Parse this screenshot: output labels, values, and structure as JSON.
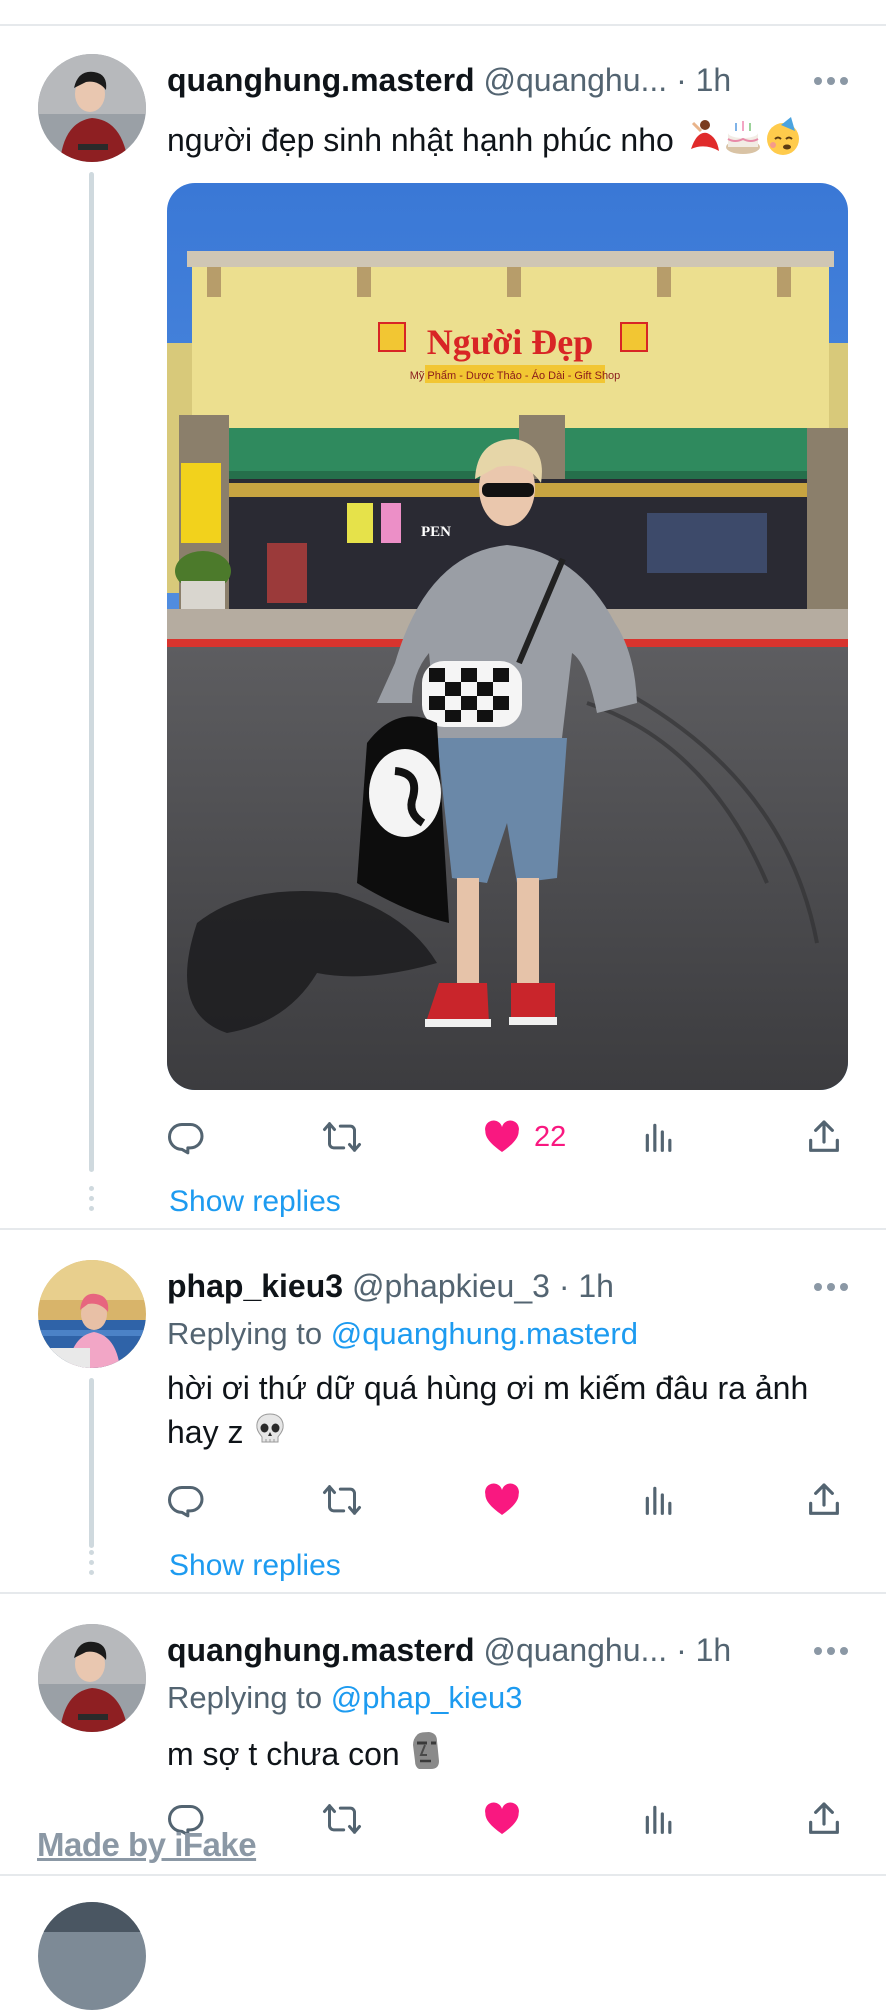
{
  "tweets": [
    {
      "name": "quanghung.masterd",
      "handle": "@quanghu...",
      "time": "· 1h",
      "text": "người đẹp sinh nhật hạnh phúc nho",
      "emojis": [
        "dancer-emoji",
        "birthday-cake-emoji",
        "partying-face-emoji"
      ],
      "photo": {
        "sign_title": "Người Đẹp",
        "sign_subtitle": "Mỹ Phẩm - Dược Thảo - Áo Dài - Gift Shop",
        "door_sign": "PEN"
      },
      "like_count": "22",
      "liked": true,
      "show_replies": "Show replies"
    },
    {
      "name": "phap_kieu3",
      "handle": "@phapkieu_3",
      "time": "· 1h",
      "replying_prefix": "Replying to",
      "replying_to": "@quanghung.masterd",
      "text_line1": "hời ơi thứ dữ quá hùng ơi m kiếm đâu ra ảnh",
      "text_line2": "hay z",
      "emoji": "skull-emoji",
      "liked": true,
      "show_replies": "Show replies"
    },
    {
      "name": "quanghung.masterd",
      "handle": "@quanghu...",
      "time": "· 1h",
      "replying_prefix": "Replying to",
      "replying_to": "@phap_kieu3",
      "text": "m sợ t chưa con",
      "emoji": "moai-emoji",
      "liked": true
    }
  ],
  "watermark": "Made by iFake",
  "colors": {
    "like": "#f91880",
    "link": "#1d9bf0",
    "secondary_text": "#536471",
    "icon": "#536471",
    "divider": "#e6e9ec"
  },
  "icons": [
    "reply-icon",
    "retweet-icon",
    "heart-icon",
    "views-icon",
    "share-icon",
    "more-icon"
  ]
}
